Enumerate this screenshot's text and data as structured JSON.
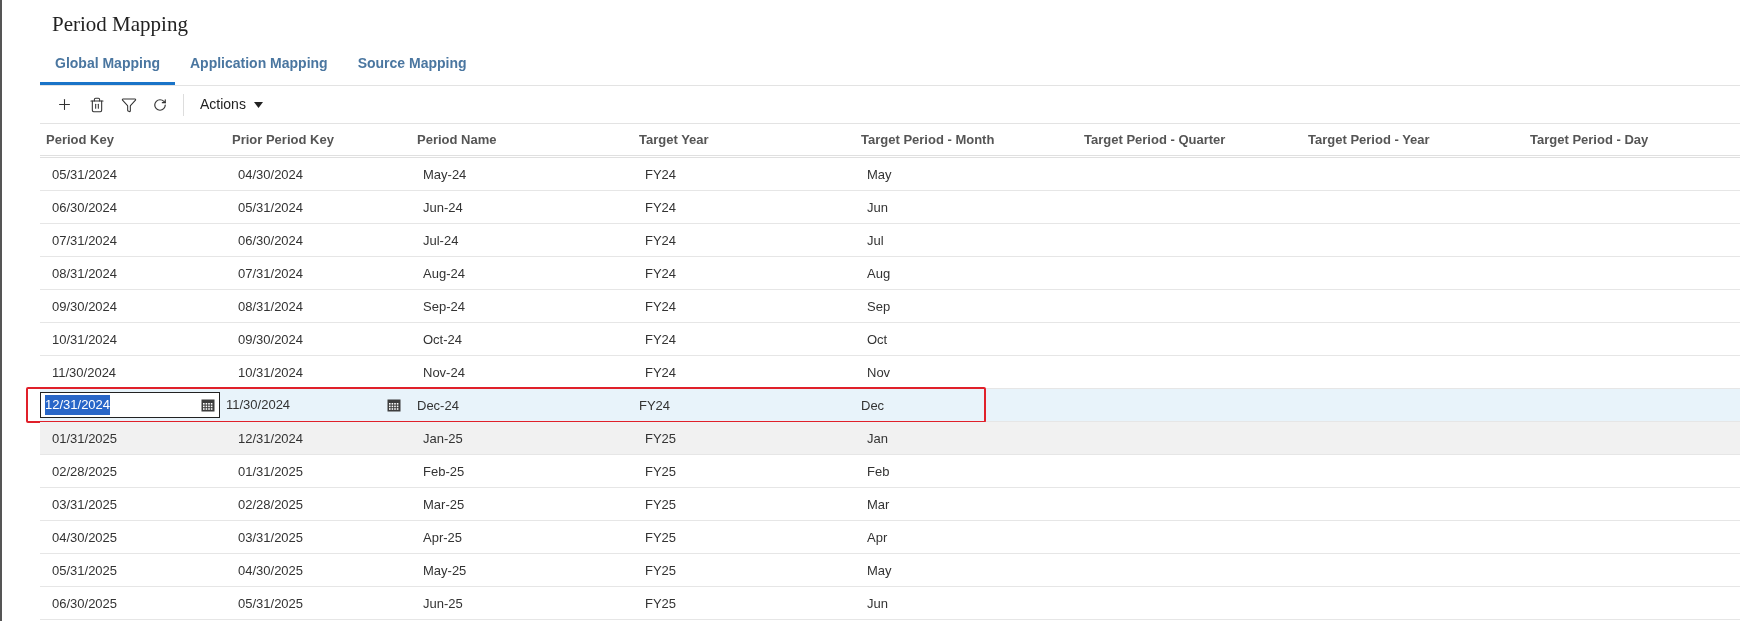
{
  "title": "Period Mapping",
  "tabs": [
    {
      "label": "Global Mapping",
      "selected": true
    },
    {
      "label": "Application Mapping",
      "selected": false
    },
    {
      "label": "Source Mapping",
      "selected": false
    }
  ],
  "toolbar": {
    "actions_label": "Actions"
  },
  "table": {
    "columns": [
      "Period Key",
      "Prior Period Key",
      "Period Name",
      "Target Year",
      "Target Period - Month",
      "Target Period - Quarter",
      "Target Period - Year",
      "Target Period - Day"
    ],
    "rows": [
      {
        "cells": [
          "05/31/2024",
          "04/30/2024",
          "May-24",
          "FY24",
          "May"
        ],
        "editing": false,
        "hovered": false
      },
      {
        "cells": [
          "06/30/2024",
          "05/31/2024",
          "Jun-24",
          "FY24",
          "Jun"
        ],
        "editing": false,
        "hovered": false
      },
      {
        "cells": [
          "07/31/2024",
          "06/30/2024",
          "Jul-24",
          "FY24",
          "Jul"
        ],
        "editing": false,
        "hovered": false
      },
      {
        "cells": [
          "08/31/2024",
          "07/31/2024",
          "Aug-24",
          "FY24",
          "Aug"
        ],
        "editing": false,
        "hovered": false
      },
      {
        "cells": [
          "09/30/2024",
          "08/31/2024",
          "Sep-24",
          "FY24",
          "Sep"
        ],
        "editing": false,
        "hovered": false
      },
      {
        "cells": [
          "10/31/2024",
          "09/30/2024",
          "Oct-24",
          "FY24",
          "Oct"
        ],
        "editing": false,
        "hovered": false
      },
      {
        "cells": [
          "11/30/2024",
          "10/31/2024",
          "Nov-24",
          "FY24",
          "Nov"
        ],
        "editing": false,
        "hovered": false
      },
      {
        "cells": [
          "12/31/2024",
          "11/30/2024",
          "Dec-24",
          "FY24",
          "Dec"
        ],
        "editing": true,
        "hovered": false
      },
      {
        "cells": [
          "01/31/2025",
          "12/31/2024",
          "Jan-25",
          "FY25",
          "Jan"
        ],
        "editing": false,
        "hovered": true
      },
      {
        "cells": [
          "02/28/2025",
          "01/31/2025",
          "Feb-25",
          "FY25",
          "Feb"
        ],
        "editing": false,
        "hovered": false
      },
      {
        "cells": [
          "03/31/2025",
          "02/28/2025",
          "Mar-25",
          "FY25",
          "Mar"
        ],
        "editing": false,
        "hovered": false
      },
      {
        "cells": [
          "04/30/2025",
          "03/31/2025",
          "Apr-25",
          "FY25",
          "Apr"
        ],
        "editing": false,
        "hovered": false
      },
      {
        "cells": [
          "05/31/2025",
          "04/30/2025",
          "May-25",
          "FY25",
          "May"
        ],
        "editing": false,
        "hovered": false
      },
      {
        "cells": [
          "06/30/2025",
          "05/31/2025",
          "Jun-25",
          "FY25",
          "Jun"
        ],
        "editing": false,
        "hovered": false
      }
    ]
  }
}
